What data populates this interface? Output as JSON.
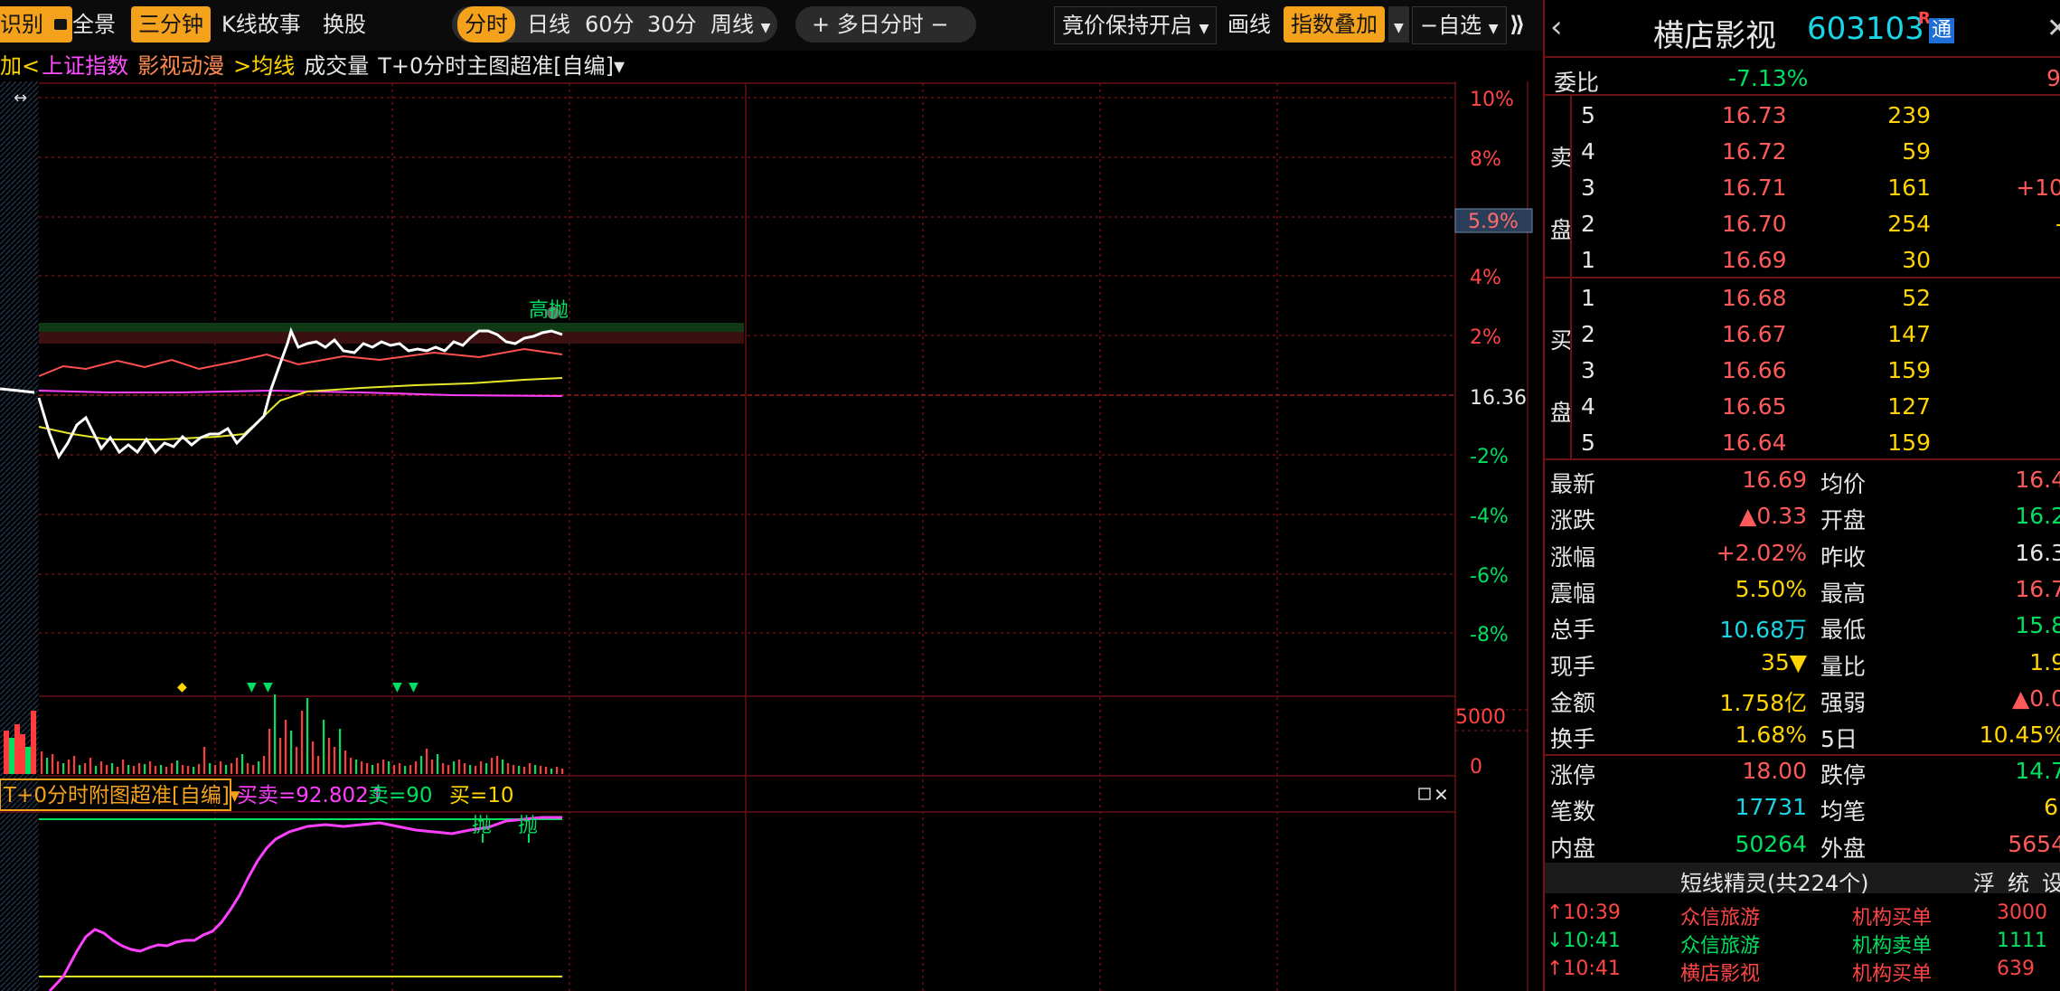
{
  "toolbar": {
    "cut_label": "识别",
    "full_view": "全景",
    "three_min": "三分钟",
    "kline_story": "K线故事",
    "switch_stock": "换股",
    "tabs": [
      "分时",
      "日线",
      "60分",
      "30分",
      "周线"
    ],
    "multi_day": "+ 多日分时 −",
    "bid_keep": "竟价保持开启",
    "draw_line": "画线",
    "index_overlay": "指数叠加",
    "watchlist": "−自选",
    "collapse": "⟫"
  },
  "indicator_row": {
    "prefix": "加<",
    "shanghai": "上证指数",
    "sector": "影视动漫",
    "avg": ">均线",
    "volume": "成交量",
    "main_formula": "T+0分时主图超准[自编]▾"
  },
  "chart": {
    "pct_labels": [
      "10%",
      "8%",
      "4%",
      "2%",
      "-2%",
      "-4%",
      "-6%",
      "-8%"
    ],
    "prev_close_label": "16.36",
    "current_pct_label": "5.9%",
    "annotation": "高抛",
    "volume_labels": [
      "5000",
      "0"
    ],
    "sub_formula": "T+0分时附图超准[自编]▾",
    "sub_values": {
      "buysell": "买卖=92.802↑",
      "sell": "卖=90",
      "buy": "买=10"
    },
    "sub_marks": [
      "抛",
      "抛"
    ],
    "colors": {
      "price": "#ffffff",
      "avg": "#e6e62a",
      "red_line": "#ff5050",
      "magenta": "#ff40ff",
      "up": "#ff3b3b",
      "down": "#00e060",
      "grid": "#6a1010"
    }
  },
  "panel": {
    "title": "横店影视",
    "code": "603103",
    "badge_r": "R",
    "badge_tong": "通",
    "back": "‹",
    "weibi_label": "委比",
    "weibi_value": "-7.13%",
    "weibi_cut": "9",
    "sell_label": [
      "卖",
      "盘"
    ],
    "buy_label": [
      "买",
      "盘"
    ],
    "asks": [
      {
        "lvl": "5",
        "price": "16.73",
        "vol": "239",
        "chg": ""
      },
      {
        "lvl": "4",
        "price": "16.72",
        "vol": "59",
        "chg": ""
      },
      {
        "lvl": "3",
        "price": "16.71",
        "vol": "161",
        "chg": "+10"
      },
      {
        "lvl": "2",
        "price": "16.70",
        "vol": "254",
        "chg": "-"
      },
      {
        "lvl": "1",
        "price": "16.69",
        "vol": "30",
        "chg": ""
      }
    ],
    "bids": [
      {
        "lvl": "1",
        "price": "16.68",
        "vol": "52"
      },
      {
        "lvl": "2",
        "price": "16.67",
        "vol": "147"
      },
      {
        "lvl": "3",
        "price": "16.66",
        "vol": "159"
      },
      {
        "lvl": "4",
        "price": "16.65",
        "vol": "127"
      },
      {
        "lvl": "5",
        "price": "16.64",
        "vol": "159"
      }
    ],
    "stats": [
      {
        "l": "最新",
        "v": "16.69",
        "vc": "red",
        "l2": "均价",
        "v2": "16.4",
        "v2c": "red"
      },
      {
        "l": "涨跌",
        "v": "▲0.33",
        "vc": "red",
        "l2": "开盘",
        "v2": "16.2",
        "v2c": "green"
      },
      {
        "l": "涨幅",
        "v": "+2.02%",
        "vc": "red",
        "l2": "昨收",
        "v2": "16.3",
        "v2c": "white"
      },
      {
        "l": "震幅",
        "v": "5.50%",
        "vc": "yellow",
        "l2": "最高",
        "v2": "16.7",
        "v2c": "red"
      },
      {
        "l": "总手",
        "v": "10.68万",
        "vc": "cyan",
        "l2": "最低",
        "v2": "15.8",
        "v2c": "green"
      },
      {
        "l": "现手",
        "v": "35▼",
        "vc": "yellow",
        "l2": "量比",
        "v2": "1.9",
        "v2c": "yellow"
      },
      {
        "l": "金额",
        "v": "1.758亿",
        "vc": "yellow",
        "l2": "强弱",
        "v2": "▲0.0",
        "v2c": "red"
      },
      {
        "l": "换手",
        "v": "1.68%",
        "vc": "yellow",
        "l2": "5日",
        "v2": "10.45%",
        "v2c": "yellow"
      }
    ],
    "limits": [
      {
        "l": "涨停",
        "v": "18.00",
        "vc": "red",
        "l2": "跌停",
        "v2": "14.7",
        "v2c": "green"
      },
      {
        "l": "笔数",
        "v": "17731",
        "vc": "cyan",
        "l2": "均笔",
        "v2": "6.",
        "v2c": "yellow"
      },
      {
        "l": "内盘",
        "v": "50264",
        "vc": "green",
        "l2": "外盘",
        "v2": "5654",
        "v2c": "red"
      }
    ],
    "spirit_title": "短线精灵(共224个)",
    "spirit_btns": [
      "浮",
      "统",
      "设"
    ],
    "spirit_rows": [
      {
        "t": "↑10:39",
        "n": "众信旅游",
        "e": "机构买单",
        "v": "3000",
        "c": "red"
      },
      {
        "t": "↓10:41",
        "n": "众信旅游",
        "e": "机构卖单",
        "v": "1111",
        "c": "green"
      },
      {
        "t": "↑10:41",
        "n": "横店影视",
        "e": "机构买单",
        "v": "639",
        "c": "red"
      }
    ]
  }
}
